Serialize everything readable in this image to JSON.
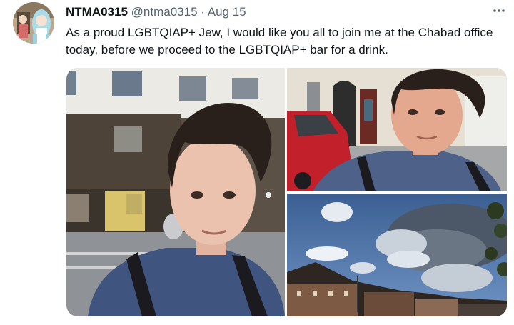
{
  "tweet": {
    "display_name": "NTMA0315",
    "handle": "@ntma0315",
    "separator": "·",
    "date": "Aug 15",
    "more_icon": "more-horizontal-icon",
    "text": "As a proud LGBTQIAP+ Jew, I would like you all to join me at the Chabad office today, before we proceed to the LGBTQIAP+ bar for a drink."
  },
  "media": {
    "photos": [
      {
        "name": "selfie-building-street"
      },
      {
        "name": "selfie-red-car"
      },
      {
        "name": "sky-clouds-rooftops"
      }
    ]
  }
}
